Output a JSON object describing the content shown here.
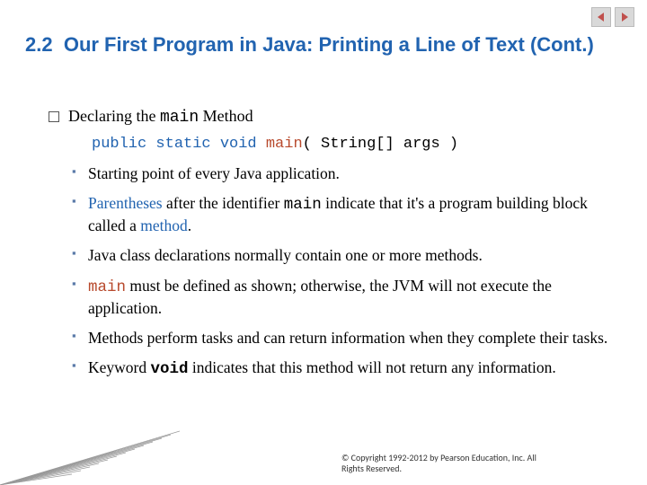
{
  "nav": {
    "prev": "previous-slide",
    "next": "next-slide"
  },
  "title": {
    "section": "2.2",
    "text": "Our First Program in Java: Printing a Line of Text (Cont.)"
  },
  "main": {
    "heading_pre": "Declaring the ",
    "heading_code": "main",
    "heading_post": " Method",
    "code": {
      "kw": "public static void",
      "fn": "main",
      "rest": "( String[] args )"
    },
    "bullets": [
      {
        "parts": [
          {
            "t": "text",
            "v": "Starting point of every Java application."
          }
        ]
      },
      {
        "parts": [
          {
            "t": "term",
            "v": "Parentheses"
          },
          {
            "t": "text",
            "v": " after the identifier "
          },
          {
            "t": "mono",
            "v": "main"
          },
          {
            "t": "text",
            "v": " indicate that it's a program building block called a "
          },
          {
            "t": "term",
            "v": "method"
          },
          {
            "t": "text",
            "v": "."
          }
        ]
      },
      {
        "parts": [
          {
            "t": "text",
            "v": "Java class declarations normally contain one or more methods."
          }
        ]
      },
      {
        "parts": [
          {
            "t": "mono-red",
            "v": "main"
          },
          {
            "t": "text",
            "v": " must be defined as shown; otherwise, the JVM will not execute the application."
          }
        ]
      },
      {
        "parts": [
          {
            "t": "text",
            "v": "Methods perform tasks and can return information when they complete their tasks."
          }
        ]
      },
      {
        "parts": [
          {
            "t": "text",
            "v": "Keyword "
          },
          {
            "t": "bold-mono",
            "v": "void"
          },
          {
            "t": "text",
            "v": " indicates that this method will not return any information."
          }
        ]
      }
    ]
  },
  "footer": {
    "copyright": "© Copyright 1992-2012 by Pearson Education, Inc. All Rights Reserved."
  }
}
